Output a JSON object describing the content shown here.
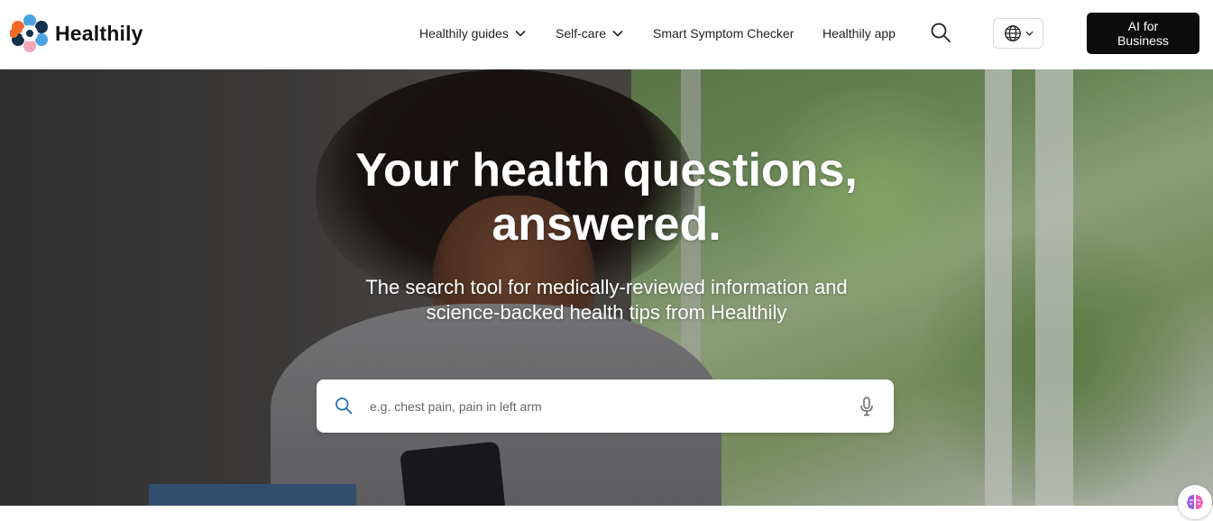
{
  "brand": {
    "name": "Healthily",
    "colors": {
      "orange": "#f26b2a",
      "navy": "#13304d",
      "sky": "#4aa3df",
      "pink": "#f2a6b8"
    }
  },
  "nav": {
    "items": [
      {
        "label": "Healthily guides",
        "has_dropdown": true
      },
      {
        "label": "Self-care",
        "has_dropdown": true
      },
      {
        "label": "Smart Symptom Checker",
        "has_dropdown": false
      },
      {
        "label": "Healthily app",
        "has_dropdown": false
      }
    ],
    "search_icon": "search-icon",
    "language_icon": "globe-icon",
    "cta_label_line1": "AI for",
    "cta_label_line2": "Business"
  },
  "hero": {
    "title_line1": "Your health questions,",
    "title_line2": "answered.",
    "subtitle_line1": "The search tool for medically-reviewed information and",
    "subtitle_line2": "science-backed health tips from Healthily",
    "search": {
      "placeholder": "e.g. chest pain, pain in left arm",
      "value": "",
      "left_icon": "search-icon",
      "right_icon": "microphone-icon"
    }
  },
  "floating": {
    "icon": "brain-icon"
  }
}
